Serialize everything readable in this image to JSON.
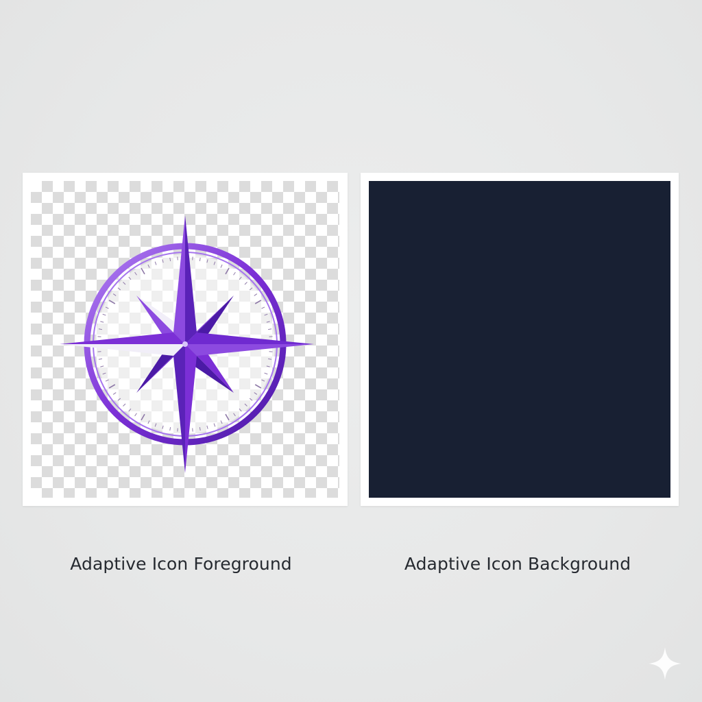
{
  "foreground": {
    "caption": "Adaptive Icon Foreground",
    "icon": "compass-rose-icon",
    "colors": {
      "primary": "#7b2fd6",
      "light": "#b183f2",
      "dark": "#4b1aa6",
      "white_facet": "#f1eef8"
    }
  },
  "background": {
    "caption": "Adaptive Icon Background",
    "color": "#182033"
  },
  "watermark": {
    "icon": "sparkle-icon"
  }
}
